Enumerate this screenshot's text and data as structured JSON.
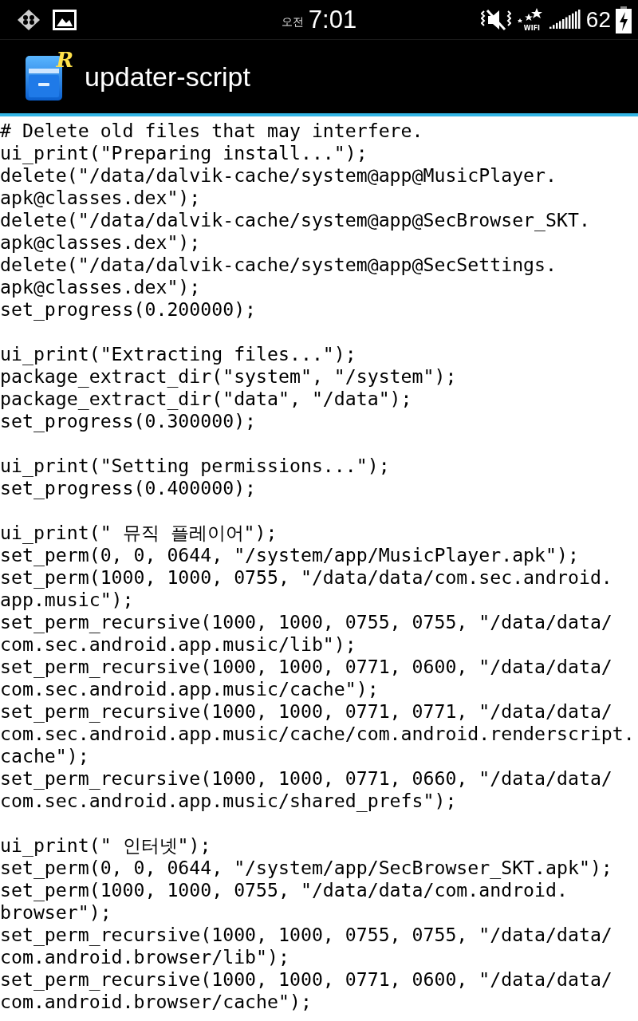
{
  "status_bar": {
    "period": "오전",
    "time": "7:01",
    "wifi_label": "WIFI",
    "battery": "62"
  },
  "app_bar": {
    "logo_mark": "R",
    "title": "updater-script"
  },
  "blocks": [
    {
      "lines": [
        "# Delete old files that may interfere.",
        "ui_print(\"Preparing install...\");",
        "delete(\"/data/dalvik-cache/system@app@MusicPlayer.",
        "apk@classes.dex\");",
        "delete(\"/data/dalvik-cache/system@app@SecBrowser_SKT.",
        "apk@classes.dex\");",
        "delete(\"/data/dalvik-cache/system@app@SecSettings.",
        "apk@classes.dex\");",
        "set_progress(0.200000);"
      ]
    },
    {
      "lines": [
        "ui_print(\"Extracting files...\");",
        "package_extract_dir(\"system\", \"/system\");",
        "package_extract_dir(\"data\", \"/data\");",
        "set_progress(0.300000);"
      ]
    },
    {
      "lines": [
        "ui_print(\"Setting permissions...\");",
        "set_progress(0.400000);"
      ]
    },
    {
      "lines": [
        "ui_print(\" 뮤직 플레이어\");",
        "set_perm(0, 0, 0644, \"/system/app/MusicPlayer.apk\");",
        "set_perm(1000, 1000, 0755, \"/data/data/com.sec.android.",
        "app.music\");",
        "set_perm_recursive(1000, 1000, 0755, 0755, \"/data/data/",
        "com.sec.android.app.music/lib\");",
        "set_perm_recursive(1000, 1000, 0771, 0600, \"/data/data/",
        "com.sec.android.app.music/cache\");",
        "set_perm_recursive(1000, 1000, 0771, 0771, \"/data/data/",
        "com.sec.android.app.music/cache/com.android.renderscript.",
        "cache\");",
        "set_perm_recursive(1000, 1000, 0771, 0660, \"/data/data/",
        "com.sec.android.app.music/shared_prefs\");"
      ]
    },
    {
      "lines": [
        "ui_print(\" 인터넷\");",
        "set_perm(0, 0, 0644, \"/system/app/SecBrowser_SKT.apk\");",
        "set_perm(1000, 1000, 0755, \"/data/data/com.android.",
        "browser\");",
        "set_perm_recursive(1000, 1000, 0755, 0755, \"/data/data/",
        "com.android.browser/lib\");",
        "set_perm_recursive(1000, 1000, 0771, 0600, \"/data/data/",
        "com.android.browser/cache\");"
      ]
    }
  ]
}
